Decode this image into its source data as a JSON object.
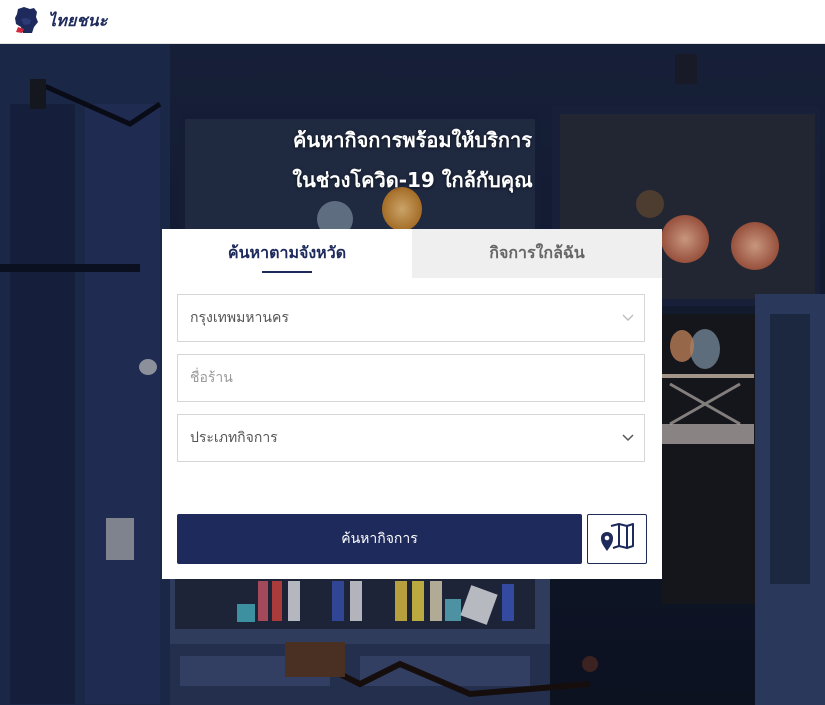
{
  "header": {
    "logo_text": "ไทยชนะ",
    "logo_icon": "raised-fist-icon"
  },
  "hero": {
    "headline_line1": "ค้นหากิจการพร้อมให้บริการ",
    "headline_line2": "ในช่วงโควิด-19 ใกล้กับคุณ"
  },
  "tabs": [
    {
      "label": "ค้นหาตามจังหวัด",
      "active": true
    },
    {
      "label": "กิจการใกล้ฉัน",
      "active": false
    }
  ],
  "form": {
    "province": {
      "value": "กรุงเทพมหานคร",
      "icon": "chevron-down-icon"
    },
    "shop_name": {
      "placeholder": "ชื่อร้าน"
    },
    "business_type": {
      "value": "ประเภทกิจการ",
      "icon": "chevron-down-icon"
    },
    "search_label": "ค้นหากิจการ",
    "map_button_icon": "map-pin-icon"
  },
  "colors": {
    "brand_navy": "#1f2a5c",
    "tab_inactive_bg": "#efefef"
  }
}
